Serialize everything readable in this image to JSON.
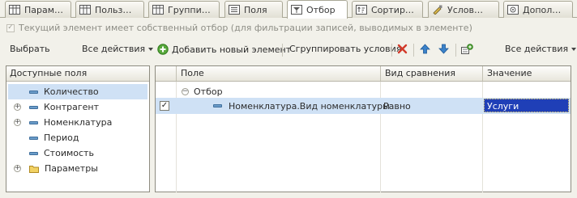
{
  "tabs": [
    {
      "label": "Парам…",
      "icon": "table-icon"
    },
    {
      "label": "Польз…",
      "icon": "table-icon"
    },
    {
      "label": "Группи…",
      "icon": "table-icon"
    },
    {
      "label": "Поля",
      "icon": "list-icon"
    },
    {
      "label": "Отбор",
      "icon": "filter-icon",
      "active": true
    },
    {
      "label": "Сортир…",
      "icon": "sort-icon"
    },
    {
      "label": "Услов…",
      "icon": "conditional-icon"
    },
    {
      "label": "Допол…",
      "icon": "settings-icon"
    }
  ],
  "own_filter": {
    "checked": true,
    "label": "Текущий элемент имеет собственный отбор (для фильтрации записей, выводимых в элементе)"
  },
  "toolbar": {
    "select_label": "Выбрать",
    "all_actions_left": "Все действия",
    "add_new_label": "Добавить новый элемент",
    "group_conditions_label": "Сгруппировать условия",
    "all_actions_right": "Все действия"
  },
  "available_fields": {
    "header": "Доступные поля",
    "items": [
      {
        "label": "Количество",
        "expandable": false,
        "icon": "field-icon",
        "selected": true
      },
      {
        "label": "Контрагент",
        "expandable": true,
        "icon": "field-icon"
      },
      {
        "label": "Номенклатура",
        "expandable": true,
        "icon": "field-icon"
      },
      {
        "label": "Период",
        "expandable": false,
        "icon": "field-icon"
      },
      {
        "label": "Стоимость",
        "expandable": false,
        "icon": "field-icon"
      },
      {
        "label": "Параметры",
        "expandable": true,
        "icon": "folder-icon"
      }
    ]
  },
  "filter_table": {
    "columns": {
      "field": "Поле",
      "comparison": "Вид сравнения",
      "value": "Значение"
    },
    "group": {
      "label": "Отбор"
    },
    "rows": [
      {
        "checked": true,
        "field": "Номенклатура.Вид номенклатуры",
        "comparison": "Равно",
        "value": "Услуги"
      }
    ]
  },
  "colors": {
    "selection": "#cfe1f5",
    "value_highlight": "#1f3fb7",
    "accent_blue": "#3f6f9d"
  }
}
